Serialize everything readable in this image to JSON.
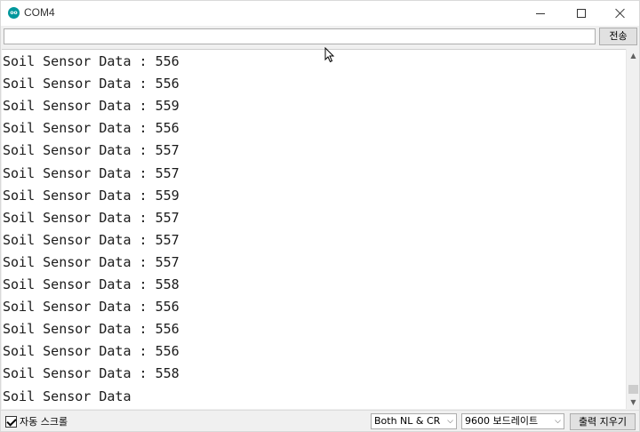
{
  "window": {
    "title": "COM4",
    "app_icon": "arduino-icon",
    "app_icon_text": "oo"
  },
  "send_bar": {
    "input_value": "",
    "send_label": "전송"
  },
  "output": {
    "lines": [
      "Soil Sensor Data : 556",
      "Soil Sensor Data : 556",
      "Soil Sensor Data : 559",
      "Soil Sensor Data : 556",
      "Soil Sensor Data : 557",
      "Soil Sensor Data : 557",
      "Soil Sensor Data : 559",
      "Soil Sensor Data : 557",
      "Soil Sensor Data : 557",
      "Soil Sensor Data : 557",
      "Soil Sensor Data : 558",
      "Soil Sensor Data : 556",
      "Soil Sensor Data : 556",
      "Soil Sensor Data : 556",
      "Soil Sensor Data : 558",
      "Soil Sensor Data"
    ]
  },
  "bottom_bar": {
    "autoscroll_label": "자동 스크롤",
    "autoscroll_checked": true,
    "line_ending_value": "Both NL & CR",
    "baud_value": "9600 보드레이트",
    "clear_label": "출력 지우기"
  }
}
